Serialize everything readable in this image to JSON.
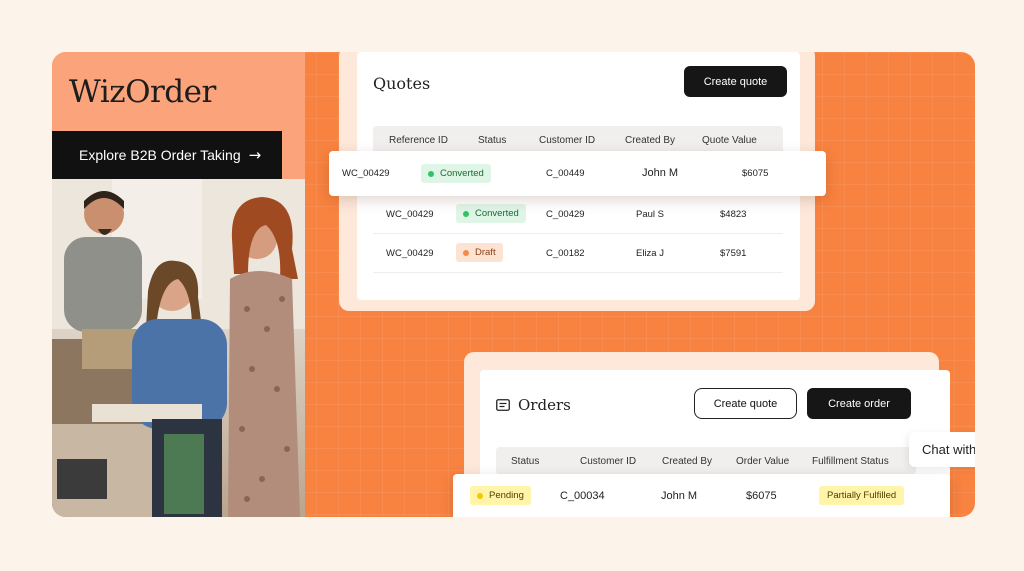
{
  "brand": {
    "logo": "WizOrder",
    "cta": "Explore B2B Order Taking",
    "cta_arrow": "→"
  },
  "quotes": {
    "title": "Quotes",
    "create_button": "Create quote",
    "columns": [
      "Reference ID",
      "Status",
      "Customer ID",
      "Created By",
      "Quote Value"
    ],
    "rows": [
      {
        "ref": "WC_00429",
        "status": "Converted",
        "customer": "C_00449",
        "created_by": "John M",
        "value": "$6075"
      },
      {
        "ref": "WC_00429",
        "status": "Converted",
        "customer": "C_00429",
        "created_by": "Paul S",
        "value": "$4823"
      },
      {
        "ref": "WC_00429",
        "status": "Draft",
        "customer": "C_00182",
        "created_by": "Eliza J",
        "value": "$7591"
      }
    ]
  },
  "orders": {
    "title": "Orders",
    "create_quote_button": "Create quote",
    "create_order_button": "Create order",
    "columns": [
      "Status",
      "Customer ID",
      "Created By",
      "Order Value",
      "Fulfillment Status"
    ],
    "rows": [
      {
        "status": "Pending",
        "customer": "C_00034",
        "created_by": "John M",
        "value": "$6075",
        "fulfillment": "Partially Fulfilled"
      }
    ]
  },
  "chat": {
    "label": "Chat with"
  },
  "colors": {
    "accent": "#f8823f",
    "panel_bg": "#fba47b",
    "page_bg": "#fcf4ea"
  },
  "icons": {
    "orders": "list-icon",
    "cta": "arrow-right-icon"
  }
}
